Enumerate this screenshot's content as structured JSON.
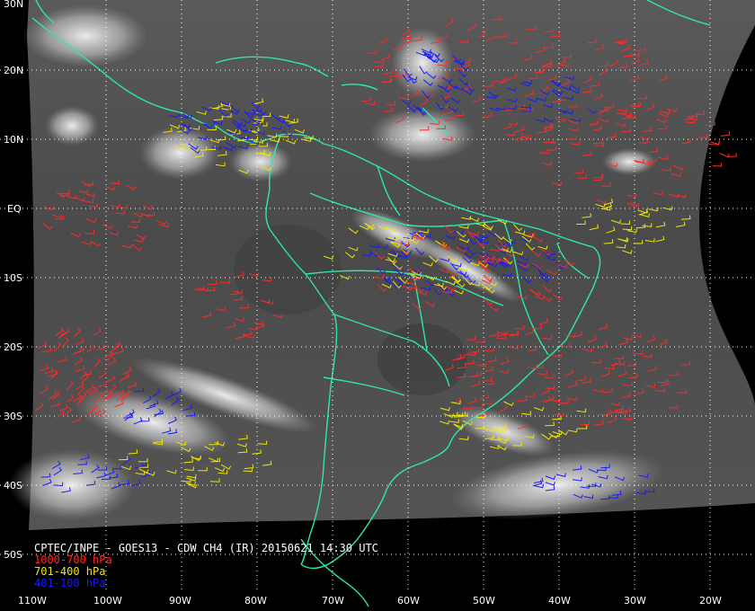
{
  "caption": {
    "title": "CPTEC/INPE - GOES13 - CDW CH4 (IR) 20150621 14:30 UTC",
    "legend": [
      {
        "text": "1000-700 hPa",
        "color": "#ff2a2a"
      },
      {
        "text": "701-400 hPa",
        "color": "#f2e600"
      },
      {
        "text": "401-100 hPa",
        "color": "#1a1aff"
      }
    ]
  },
  "lat_labels": [
    "30N",
    "20N",
    "10N",
    "EQ",
    "10S",
    "20S",
    "30S",
    "40S",
    "50S"
  ],
  "lon_labels": [
    "110W",
    "100W",
    "90W",
    "80W",
    "70W",
    "60W",
    "50W",
    "40W",
    "30W",
    "20W"
  ],
  "colors": {
    "coastline": "#2ee8a8",
    "grid": "#ffffff",
    "background": "#000000",
    "low_level_wind": "#ff2a2a",
    "mid_level_wind": "#f2e600",
    "high_level_wind": "#1a1aff"
  }
}
